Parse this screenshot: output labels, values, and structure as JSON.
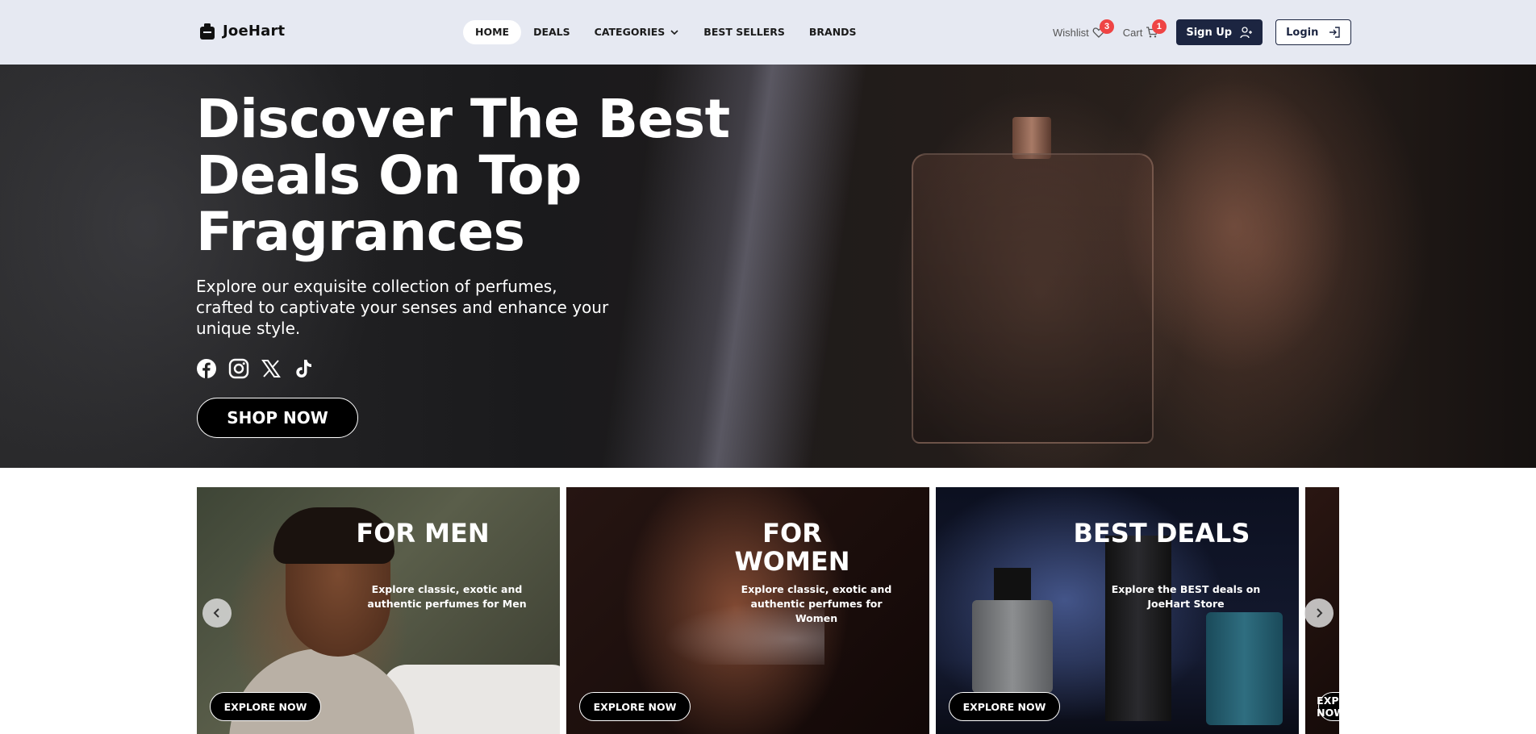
{
  "brand": {
    "name": "JoeHart"
  },
  "nav": {
    "items": [
      {
        "label": "HOME",
        "active": true
      },
      {
        "label": "DEALS"
      },
      {
        "label": "CATEGORIES"
      },
      {
        "label": "BEST SELLERS"
      },
      {
        "label": "BRANDS"
      }
    ],
    "wishlist": {
      "label": "Wishlist",
      "count": "3"
    },
    "cart": {
      "label": "Cart",
      "count": "1"
    },
    "signup_label": "Sign Up",
    "login_label": "Login"
  },
  "hero": {
    "title": "Discover The Best Deals On Top Fragrances",
    "subtitle": "Explore our exquisite collection of perfumes, crafted to captivate your senses and enhance your unique style.",
    "socials": [
      "facebook-icon",
      "instagram-icon",
      "x-icon",
      "tiktok-icon"
    ],
    "cta_label": "SHOP NOW"
  },
  "cards": [
    {
      "title": "FOR MEN",
      "description": "Explore classic, exotic and authentic perfumes for Men",
      "button": "EXPLORE NOW"
    },
    {
      "title": "FOR WOMEN",
      "description": "Explore classic, exotic and authentic perfumes for Women",
      "button": "EXPLORE NOW"
    },
    {
      "title": "BEST DEALS",
      "description": "Explore the BEST deals on JoeHart Store",
      "button": "EXPLORE NOW"
    },
    {
      "title": "",
      "description": "",
      "button": "EXPLORE NOW"
    }
  ],
  "colors": {
    "nav_bg": "#e6e9f2",
    "primary": "#1c2541",
    "badge": "#ef4444"
  }
}
